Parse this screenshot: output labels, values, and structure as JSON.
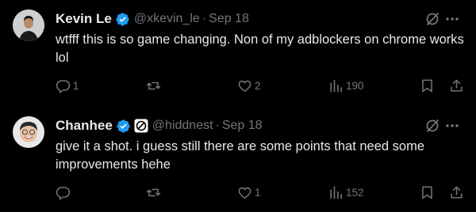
{
  "tweets": [
    {
      "author_name": "Kevin Le",
      "handle": "@xkevin_le",
      "separator": "·",
      "date": "Sep 18",
      "text": "wtfff this is so game changing. Non of my adblockers on chrome works lol",
      "reply_count": "1",
      "repost_count": "",
      "like_count": "2",
      "view_count": "190"
    },
    {
      "author_name": "Chanhee",
      "handle": "@hiddnest",
      "separator": "·",
      "date": "Sep 18",
      "text": "give it a shot. i guess still there are some points that need some improvements hehe",
      "reply_count": "",
      "repost_count": "",
      "like_count": "1",
      "view_count": "152"
    }
  ],
  "colors": {
    "background": "#000000",
    "primary_text": "#e7e9ea",
    "secondary_text": "#71767b",
    "verified": "#1d9bf0"
  },
  "icons": [
    "verified-badge-icon",
    "affiliate-badge-icon",
    "grok-icon",
    "more-icon",
    "reply-icon",
    "repost-icon",
    "like-icon",
    "views-icon",
    "bookmark-icon",
    "share-icon"
  ]
}
